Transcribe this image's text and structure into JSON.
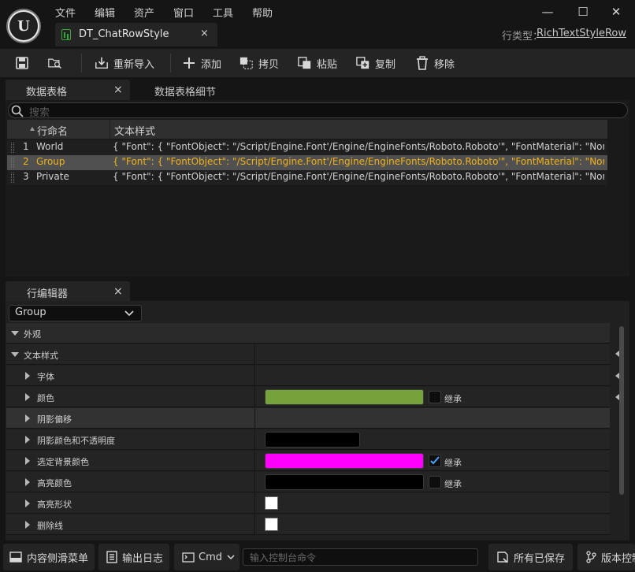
{
  "menu": [
    "文件",
    "编辑",
    "资产",
    "窗口",
    "工具",
    "帮助"
  ],
  "window": {
    "minimize": "—",
    "maximize": "☐",
    "close": "✕"
  },
  "doc_tab": {
    "title": "DT_ChatRowStyle",
    "close": "×"
  },
  "row_type": {
    "label": "行类型：",
    "value": "RichTextStyleRow"
  },
  "toolbar": {
    "reimport": "重新导入",
    "add": "添加",
    "copy": "拷贝",
    "paste": "粘贴",
    "duplicate": "复制",
    "remove": "移除"
  },
  "table_panel": {
    "tabs": [
      "数据表格",
      "数据表格细节"
    ],
    "close": "×",
    "search_placeholder": "搜索",
    "columns": [
      "行命名",
      "文本样式"
    ],
    "rows": [
      {
        "num": "1",
        "name": "World",
        "value": "{ \"Font\": { \"FontObject\": \"/Script/Engine.Font'/Engine/EngineFonts/Roboto.Roboto'\", \"FontMaterial\": \"None\", \"OutlineS"
      },
      {
        "num": "2",
        "name": "Group",
        "value": "{ \"Font\": { \"FontObject\": \"/Script/Engine.Font'/Engine/EngineFonts/Roboto.Roboto'\", \"FontMaterial\": \"None\", \"OutlineS"
      },
      {
        "num": "3",
        "name": "Private",
        "value": "{ \"Font\": { \"FontObject\": \"/Script/Engine.Font'/Engine/EngineFonts/Roboto.Roboto'\", \"FontMaterial\": \"None\", \"OutlineS"
      }
    ],
    "selected_row": 1
  },
  "row_editor": {
    "tab": "行编辑器",
    "close": "×",
    "selected": "Group",
    "category": "外观",
    "group": "文本样式",
    "inherit_label": "继承",
    "properties": {
      "font": "字体",
      "color": "颜色",
      "shadow_offset": "阴影偏移",
      "shadow_color": "阴影颜色和不透明度",
      "selected_bg": "选定背景颜色",
      "highlight_color": "高亮颜色",
      "highlight_shape": "高亮形状",
      "strikethrough": "删除线"
    }
  },
  "colors": {
    "text_color_swatch": "#75a23a",
    "shadow_color_swatch": "#000000",
    "selected_bg_swatch": "#ff00ff",
    "highlight_color_swatch": "#000000",
    "selected_row_text": "#f0b21a",
    "checkbox_check": "#4aa3ff"
  },
  "statusbar": {
    "drawer": "内容侧滑菜单",
    "output_log": "输出日志",
    "cmd": "Cmd",
    "console_placeholder": "输入控制台命令",
    "saved": "所有已保存",
    "source_control": "版本控制"
  }
}
